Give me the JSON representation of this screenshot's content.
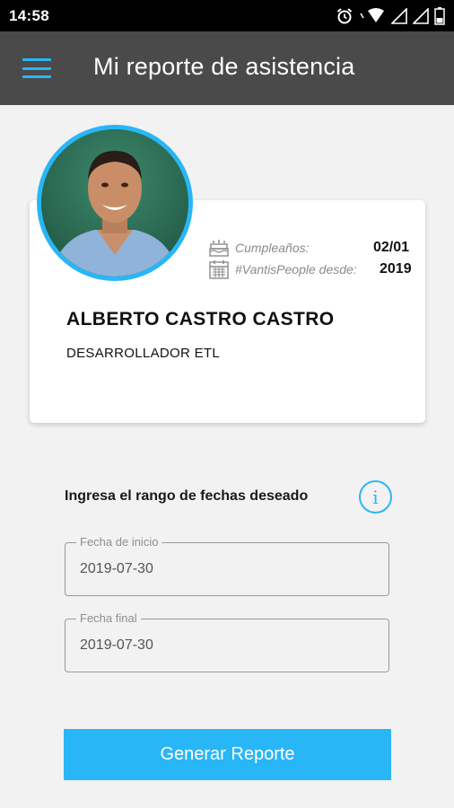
{
  "status_bar": {
    "time": "14:58"
  },
  "app_bar": {
    "title": "Mi reporte de asistencia"
  },
  "profile": {
    "birthday_label": "Cumpleaños:",
    "birthday_value": "02/01",
    "since_label": "#VantisPeople desde:",
    "since_value": "2019",
    "name": "ALBERTO CASTRO CASTRO",
    "role": "DESARROLLADOR ETL"
  },
  "report_form": {
    "range_label": "Ingresa el rango de fechas deseado",
    "start_label": "Fecha de inicio",
    "start_value": "2019-07-30",
    "end_label": "Fecha final",
    "end_value": "2019-07-30",
    "generate_label": "Generar Reporte"
  },
  "colors": {
    "accent": "#29b6f6",
    "app_bar": "#4a4a4a",
    "background": "#f2f2f2"
  }
}
